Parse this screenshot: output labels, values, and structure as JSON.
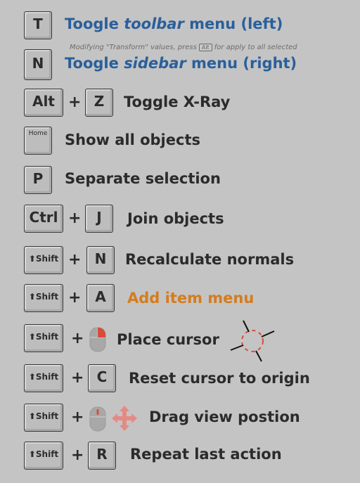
{
  "rows": [
    {
      "keys": [
        "T"
      ],
      "label_pre": "Toogle ",
      "label_em": "toolbar",
      "label_post": " menu (left)"
    },
    {
      "keys": [
        "N"
      ],
      "label_pre": "Toogle ",
      "label_em": "sidebar",
      "label_post": " menu (right)"
    },
    {
      "keys": [
        "Alt",
        "Z"
      ],
      "label": "Toggle X-Ray"
    },
    {
      "keys": [
        "Home"
      ],
      "label": "Show all objects"
    },
    {
      "keys": [
        "P"
      ],
      "label": "Separate selection"
    },
    {
      "keys": [
        "Ctrl",
        "J"
      ],
      "label": "Join objects"
    },
    {
      "keys": [
        "Shift",
        "N"
      ],
      "label": "Recalculate normals"
    },
    {
      "keys": [
        "Shift",
        "A"
      ],
      "label": "Add item menu"
    },
    {
      "keys": [
        "Shift"
      ],
      "label": "Place cursor"
    },
    {
      "keys": [
        "Shift",
        "C"
      ],
      "label": "Reset cursor to origin"
    },
    {
      "keys": [
        "Shift"
      ],
      "label": "Drag view postion"
    },
    {
      "keys": [
        "Shift",
        "R"
      ],
      "label": "Repeat last action"
    }
  ],
  "note": {
    "pre": "Modifying \"Transform\" values, press",
    "key": "Alt",
    "post": "for apply to all selected"
  },
  "plus": "+",
  "colors": {
    "background": "#c4c4c4",
    "blue": "#2a5f9a",
    "orange": "#d47c1f",
    "mouse_accent": "#d94c3a"
  },
  "icons": [
    "shift-arrow-icon",
    "mouse-right-button-icon",
    "mouse-middle-button-icon",
    "move-arrows-icon",
    "3d-cursor-icon"
  ]
}
